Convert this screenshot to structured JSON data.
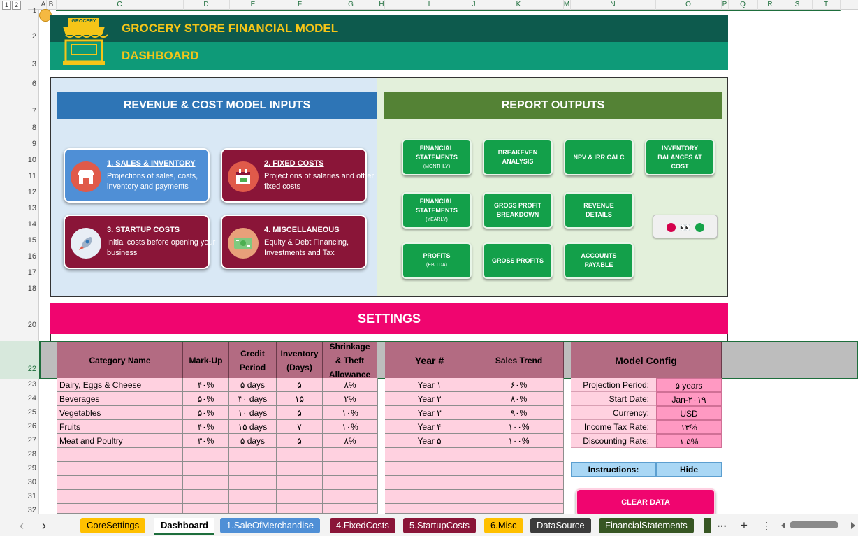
{
  "outline_levels": [
    "1",
    "2"
  ],
  "columns": [
    "A",
    "B",
    "C",
    "D",
    "E",
    "F",
    "G",
    "H",
    "I",
    "J",
    "K",
    "L",
    "M",
    "N",
    "O",
    "P",
    "Q",
    "R",
    "S",
    "T"
  ],
  "rows": [
    "1",
    "2",
    "3",
    "6",
    "7",
    "8",
    "9",
    "10",
    "11",
    "12",
    "13",
    "14",
    "15",
    "16",
    "17",
    "18",
    "20",
    "22",
    "23",
    "24",
    "25",
    "26",
    "27",
    "28",
    "29",
    "30",
    "31",
    "32"
  ],
  "header": {
    "logo_text": "GROCERY",
    "title": "GROCERY STORE FINANCIAL MODEL",
    "subtitle": "DASHBOARD"
  },
  "inputs": {
    "heading": "REVENUE & COST MODEL INPUTS",
    "cards": [
      {
        "title": "1. SALES & INVENTORY",
        "desc": "Projections of sales, costs, inventory and payments",
        "icon": "store-icon"
      },
      {
        "title": "2. FIXED COSTS",
        "desc": "Projections of salaries and other fixed costs",
        "icon": "calendar-money-icon"
      },
      {
        "title": "3. STARTUP COSTS",
        "desc": "Initial costs before opening your business",
        "icon": "rocket-icon"
      },
      {
        "title": "4. MISCELLANEOUS",
        "desc": "Equity & Debt Financing, Investments and Tax",
        "icon": "cash-icon"
      }
    ]
  },
  "outputs": {
    "heading": "REPORT OUTPUTS",
    "buttons": [
      {
        "label": "FINANCIAL STATEMENTS",
        "sub": "(MONTHLY)"
      },
      {
        "label": "BREAKEVEN ANALYSIS",
        "sub": ""
      },
      {
        "label": "NPV & IRR CALC",
        "sub": ""
      },
      {
        "label": "INVENTORY BALANCES AT COST",
        "sub": ""
      },
      {
        "label": "FINANCIAL STATEMENTS",
        "sub": "(YEARLY)"
      },
      {
        "label": "GROSS PROFIT BREAKDOWN",
        "sub": ""
      },
      {
        "label": "REVENUE DETAILS",
        "sub": ""
      },
      {
        "label": "PROFITS",
        "sub": "(EBITDA)"
      },
      {
        "label": "GROSS PROFITS",
        "sub": ""
      },
      {
        "label": "ACCOUNTS PAYABLE",
        "sub": ""
      }
    ],
    "nav_glyph": "👀"
  },
  "settings": {
    "title": "SETTINGS",
    "category_headers": [
      "Category Name",
      "Mark-Up",
      "Credit Period",
      "Inventory (Days)",
      "Shrinkage & Theft Allowance"
    ],
    "categories": [
      [
        "Dairy, Eggs & Cheese",
        "۴۰%",
        "۵ days",
        "۵",
        "۸%"
      ],
      [
        "Beverages",
        "۵۰%",
        "۳۰ days",
        "۱۵",
        "۲%"
      ],
      [
        "Vegetables",
        "۵۰%",
        "۱۰ days",
        "۵",
        "۱۰%"
      ],
      [
        "Fruits",
        "۴۰%",
        "۱۵ days",
        "۷",
        "۱۰%"
      ],
      [
        "Meat and Poultry",
        "۳۰%",
        "۵ days",
        "۵",
        "۸%"
      ]
    ],
    "trend_headers": [
      "Year #",
      "Sales Trend"
    ],
    "trend": [
      [
        "Year ۱",
        "۶۰%"
      ],
      [
        "Year ۲",
        "۸۰%"
      ],
      [
        "Year ۳",
        "۹۰%"
      ],
      [
        "Year ۴",
        "۱۰۰%"
      ],
      [
        "Year ۵",
        "۱۰۰%"
      ]
    ],
    "config_header": "Model Config",
    "config": [
      [
        "Projection Period:",
        "۵ years"
      ],
      [
        "Start Date:",
        "Jan-۲۰۱۹"
      ],
      [
        "Currency:",
        "USD"
      ],
      [
        "Income Tax Rate:",
        "۱۳%"
      ],
      [
        "Discounting Rate:",
        "۱.۵%"
      ]
    ],
    "instructions_label": "Instructions:",
    "instructions_toggle": "Hide",
    "clear_label": "CLEAR DATA"
  },
  "tabs": [
    {
      "label": "CoreSettings",
      "bg": "#ffc000",
      "fg": "#000000"
    },
    {
      "label": "Dashboard",
      "bg": "#ffffff",
      "fg": "#000000"
    },
    {
      "label": "1.SaleOfMerchandise",
      "bg": "#4f8fd6",
      "fg": "#ffffff"
    },
    {
      "label": "4.FixedCosts",
      "bg": "#8a1538",
      "fg": "#ffffff"
    },
    {
      "label": "5.StartupCosts",
      "bg": "#8a1538",
      "fg": "#ffffff"
    },
    {
      "label": "6.Misc",
      "bg": "#ffc000",
      "fg": "#000000"
    },
    {
      "label": "DataSource",
      "bg": "#3b3b3b",
      "fg": "#ffffff"
    },
    {
      "label": "FinancialStatements",
      "bg": "#375623",
      "fg": "#ffffff"
    }
  ],
  "tabbar_controls": {
    "prev": "‹",
    "next": "›",
    "more": "⋯",
    "add": "+",
    "options": "⋮"
  }
}
